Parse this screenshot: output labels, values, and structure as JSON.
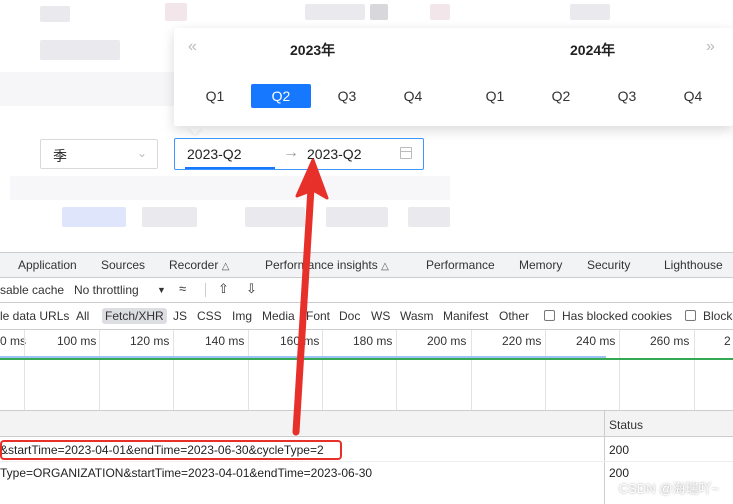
{
  "picker": {
    "years": [
      "2023年",
      "2024年"
    ],
    "prev_icon": "«",
    "next_icon": "»",
    "quarters_left": [
      "Q1",
      "Q2",
      "Q3",
      "Q4"
    ],
    "quarters_right": [
      "Q1",
      "Q2",
      "Q3",
      "Q4"
    ],
    "selected_quarter": "Q2"
  },
  "filter": {
    "select_value": "季",
    "range_start": "2023-Q2",
    "range_end": "2023-Q2",
    "range_arrow": "→"
  },
  "devtools": {
    "tabs": [
      "Application",
      "Sources",
      "Recorder",
      "Performance insights",
      "Performance",
      "Memory",
      "Security",
      "Lighthouse"
    ],
    "toolbar": {
      "cache": "sable cache",
      "throttling": "No throttling",
      "throttle_arrow": "▼"
    },
    "filters": [
      "le data URLs",
      "All",
      "Fetch/XHR",
      "JS",
      "CSS",
      "Img",
      "Media",
      "Font",
      "Doc",
      "WS",
      "Wasm",
      "Manifest",
      "Other"
    ],
    "checkbox_blocked_cookies": "Has blocked cookies",
    "checkbox_blocked": "Block",
    "ticks": [
      "0 ms",
      "100 ms",
      "120 ms",
      "140 ms",
      "160 ms",
      "180 ms",
      "200 ms",
      "220 ms",
      "240 ms",
      "260 ms",
      "2"
    ],
    "table_header": {
      "status": "Status"
    },
    "rows": [
      {
        "name": "&startTime=2023-04-01&endTime=2023-06-30&cycleType=2",
        "status": "200"
      },
      {
        "name": "Type=ORGANIZATION&startTime=2023-04-01&endTime=2023-06-30",
        "status": "200"
      }
    ]
  },
  "colors": {
    "accent": "#1677ff",
    "annotation_red": "#e8302a",
    "timeline_green": "#35a853"
  },
  "watermark": "CSDN @海瑞吖~"
}
